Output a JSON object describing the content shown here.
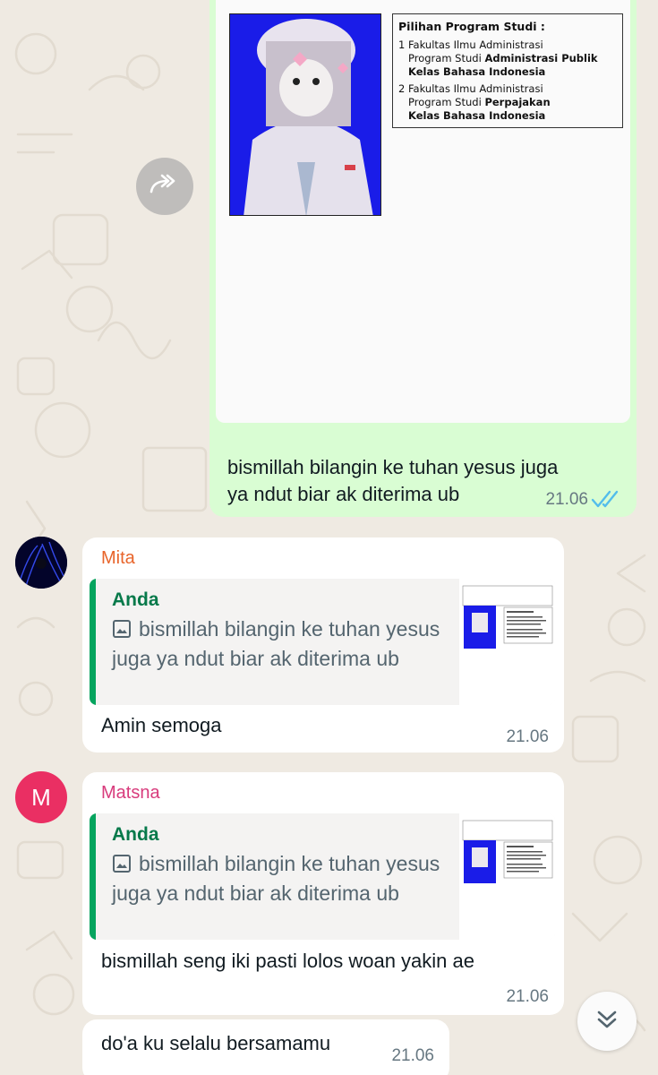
{
  "outgoing_message": {
    "document": {
      "title": "Pilihan Program Studi :",
      "choices": [
        {
          "num": "1",
          "line1": "Fakultas Ilmu Administrasi",
          "line2_prefix": "Program Studi ",
          "line2_bold": "Administrasi Publik",
          "line3": "Kelas Bahasa Indonesia"
        },
        {
          "num": "2",
          "line1": "Fakultas Ilmu Administrasi",
          "line2_prefix": "Program Studi ",
          "line2_bold": "Perpajakan",
          "line3": "Kelas Bahasa Indonesia"
        }
      ]
    },
    "text_line1": "bismillah bilangin ke tuhan yesus juga",
    "text_line2": "ya ndut biar ak diterima ub",
    "time": "21.06"
  },
  "messages": [
    {
      "sender": "Mita",
      "quote_author": "Anda",
      "quote_text": "bismillah bilangin ke tuhan yesus juga ya ndut biar ak diterima ub",
      "text": "Amin semoga",
      "time": "21.06"
    },
    {
      "sender": "Matsna",
      "avatar_letter": "M",
      "quote_author": "Anda",
      "quote_text": "bismillah bilangin ke tuhan yesus juga ya ndut biar ak diterima ub",
      "text": "bismillah seng iki pasti lolos woan yakin ae",
      "time": "21.06"
    },
    {
      "text": "do'a ku selalu bersamamu",
      "time": "21.06"
    }
  ],
  "icons": {
    "forward": "forward-icon",
    "read_receipt": "double-check-icon",
    "image": "image-icon",
    "scroll": "chevron-double-down-icon"
  },
  "colors": {
    "background": "#efeae2",
    "outgoing": "#d9fdd3",
    "incoming": "#ffffff",
    "read_tick": "#53bdeb",
    "sender_mita": "#e8642a",
    "sender_matsna": "#d83b7c",
    "quote_bar": "#06a45e"
  }
}
